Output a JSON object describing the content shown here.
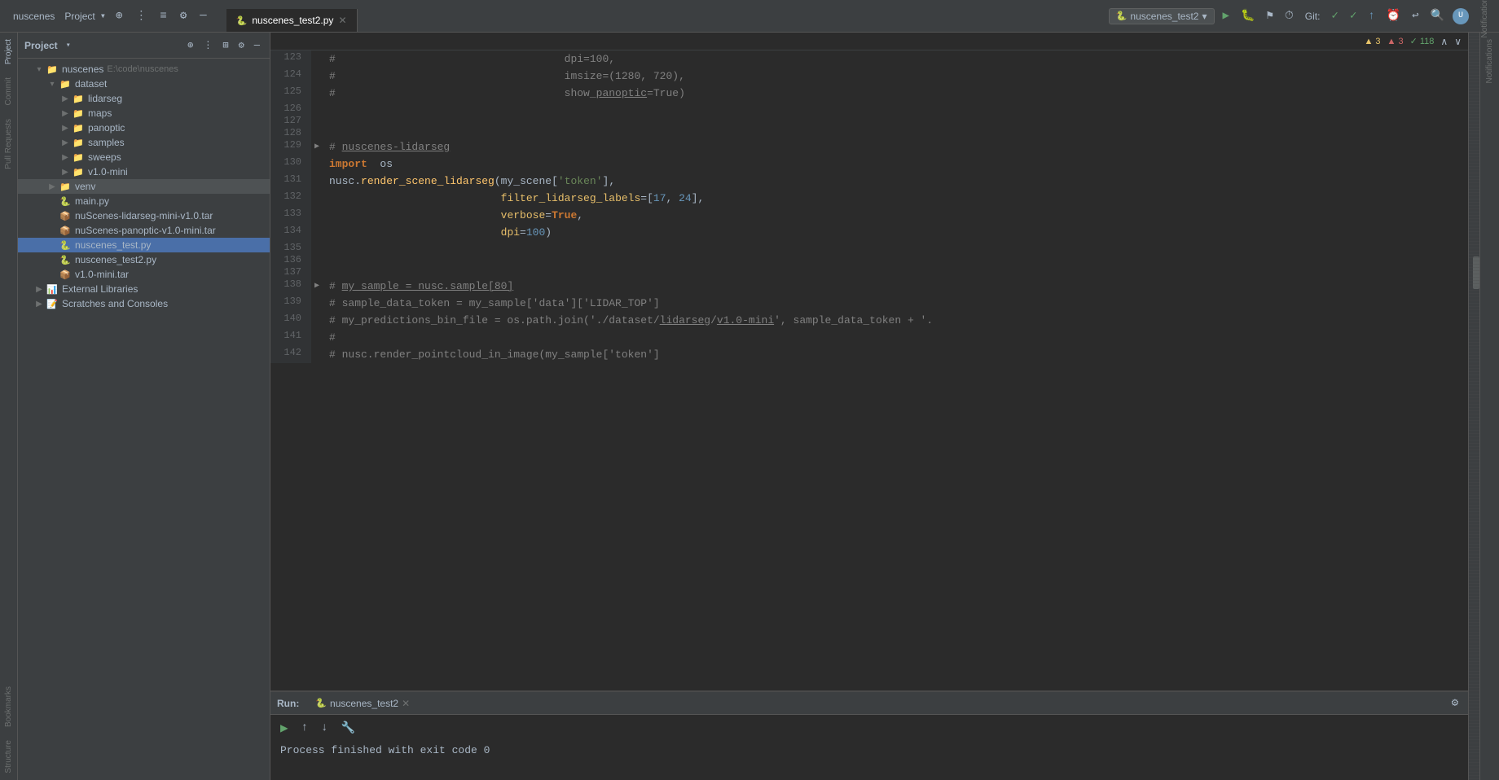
{
  "topBar": {
    "projectLabel": "nuscenes",
    "fileTab": "nuscenes_test2.py",
    "runConfig": "nuscenes_test2",
    "gitLabel": "Git:",
    "notifications": "Notifications"
  },
  "warnings": {
    "warnCount1": "▲ 3",
    "warnCount2": "▲ 3",
    "okCount": "✓ 118",
    "chevronUp": "∧",
    "chevronDown": "∨"
  },
  "sidebar": {
    "panelTitle": "Project",
    "rootLabel": "nuscenes",
    "rootPath": "E:\\code\\nuscenes",
    "items": [
      {
        "id": "dataset",
        "label": "dataset",
        "type": "folder",
        "level": 1,
        "expanded": true
      },
      {
        "id": "lidarseg",
        "label": "lidarseg",
        "type": "folder",
        "level": 2,
        "expanded": false
      },
      {
        "id": "maps",
        "label": "maps",
        "type": "folder",
        "level": 2,
        "expanded": false
      },
      {
        "id": "panoptic",
        "label": "panoptic",
        "type": "folder",
        "level": 2,
        "expanded": false
      },
      {
        "id": "samples",
        "label": "samples",
        "type": "folder",
        "level": 2,
        "expanded": false
      },
      {
        "id": "sweeps",
        "label": "sweeps",
        "type": "folder",
        "level": 2,
        "expanded": false
      },
      {
        "id": "v1.0-mini",
        "label": "v1.0-mini",
        "type": "folder",
        "level": 2,
        "expanded": false
      },
      {
        "id": "venv",
        "label": "venv",
        "type": "folder",
        "level": 1,
        "expanded": false
      },
      {
        "id": "main.py",
        "label": "main.py",
        "type": "py",
        "level": 1
      },
      {
        "id": "nuScenes-lidarseg-mini-v1.0.tar",
        "label": "nuScenes-lidarseg-mini-v1.0.tar",
        "type": "tar",
        "level": 1
      },
      {
        "id": "nuScenes-panoptic-v1.0-mini.tar",
        "label": "nuScenes-panoptic-v1.0-mini.tar",
        "type": "tar",
        "level": 1
      },
      {
        "id": "nuscenes_test.py",
        "label": "nuscenes_test.py",
        "type": "py",
        "level": 1,
        "selected": true
      },
      {
        "id": "nuscenes_test2.py",
        "label": "nuscenes_test2.py",
        "type": "py",
        "level": 1
      },
      {
        "id": "v1.0-mini.tar",
        "label": "v1.0-mini.tar",
        "type": "tar",
        "level": 1
      }
    ],
    "externalLibraries": "External Libraries",
    "scratchesAndConsoles": "Scratches and Consoles"
  },
  "editor": {
    "activeTab": "nuscenes_test2.py",
    "lines": [
      {
        "num": 123,
        "content": "#                                    dpi=100,",
        "fold": false,
        "type": "comment"
      },
      {
        "num": 124,
        "content": "#                                    imsize=(1280, 720),",
        "fold": false,
        "type": "comment"
      },
      {
        "num": 125,
        "content": "#                                    show_panoptic=True)",
        "fold": false,
        "type": "comment"
      },
      {
        "num": 126,
        "content": "",
        "fold": false,
        "type": "blank"
      },
      {
        "num": 127,
        "content": "",
        "fold": false,
        "type": "blank"
      },
      {
        "num": 128,
        "content": "",
        "fold": false,
        "type": "blank"
      },
      {
        "num": 129,
        "content": "# nuscenes-lidarseg",
        "fold": true,
        "type": "comment-heading"
      },
      {
        "num": 130,
        "content": "import os",
        "fold": false,
        "type": "code"
      },
      {
        "num": 131,
        "content": "nusc.render_scene_lidarseg(my_scene['token'],",
        "fold": false,
        "type": "code"
      },
      {
        "num": 132,
        "content": "                           filter_lidarseg_labels=[17, 24],",
        "fold": false,
        "type": "code"
      },
      {
        "num": 133,
        "content": "                           verbose=True,",
        "fold": false,
        "type": "code"
      },
      {
        "num": 134,
        "content": "                           dpi=100)",
        "fold": false,
        "type": "code"
      },
      {
        "num": 135,
        "content": "",
        "fold": false,
        "type": "blank"
      },
      {
        "num": 136,
        "content": "",
        "fold": false,
        "type": "blank"
      },
      {
        "num": 137,
        "content": "",
        "fold": false,
        "type": "blank"
      },
      {
        "num": 138,
        "content": "# my_sample = nusc.sample[80]",
        "fold": true,
        "type": "comment-heading"
      },
      {
        "num": 139,
        "content": "# sample_data_token = my_sample['data']['LIDAR_TOP']",
        "fold": false,
        "type": "comment"
      },
      {
        "num": 140,
        "content": "# my_predictions_bin_file = os.path.join('./dataset/lidarseg/v1.0-mini', sample_data_token + '.",
        "fold": false,
        "type": "comment"
      },
      {
        "num": 141,
        "content": "#",
        "fold": false,
        "type": "comment"
      },
      {
        "num": 142,
        "content": "# nusc.render_pointcloud_in_image(my_sample['token']",
        "fold": false,
        "type": "comment"
      }
    ]
  },
  "runPanel": {
    "tabLabel": "nuscenes_test2",
    "output": "Process finished with exit code 0"
  },
  "leftSidebarIcons": [
    {
      "name": "Project",
      "active": true
    },
    {
      "name": "Commit",
      "active": false
    },
    {
      "name": "Pull Requests",
      "active": false
    },
    {
      "name": "Bookmarks",
      "active": false
    },
    {
      "name": "Structure",
      "active": false
    }
  ],
  "rightSidebarIcons": [
    {
      "name": "Notifications"
    }
  ]
}
